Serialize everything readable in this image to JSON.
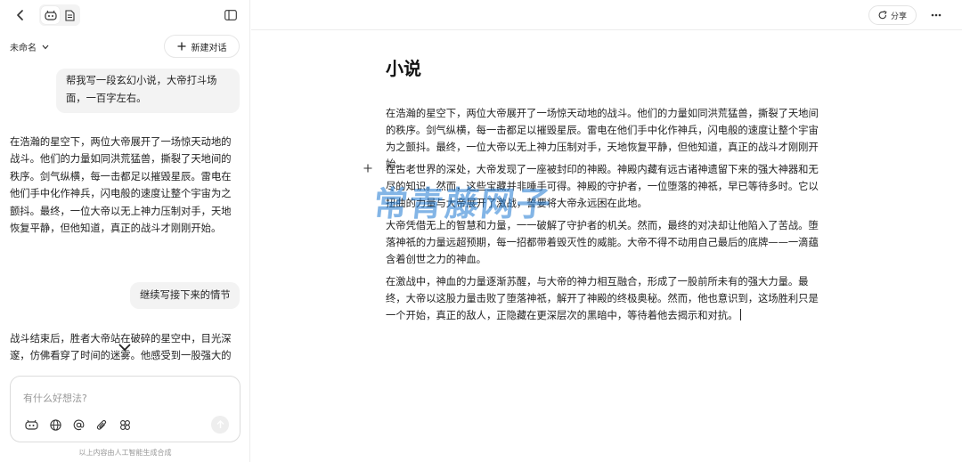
{
  "left_panel": {
    "conversation_title": "未命名",
    "new_chat_label": "新建对话",
    "messages": [
      {
        "role": "user",
        "text": "帮我写一段玄幻小说，大帝打斗场面，一百字左右。"
      },
      {
        "role": "assistant",
        "text": "在浩瀚的星空下，两位大帝展开了一场惊天动地的战斗。他们的力量如同洪荒猛兽，撕裂了天地间的秩序。剑气纵横，每一击都足以摧毁星辰。雷电在他们手中化作神兵，闪电般的速度让整个宇宙为之颤抖。最终，一位大帝以无上神力压制对手，天地恢复平静，但他知道，真正的战斗才刚刚开始。"
      },
      {
        "role": "user",
        "text": "继续写接下来的情节"
      },
      {
        "role": "assistant",
        "text": "战斗结束后，胜者大帝站在破碎的星空中，目光深邃，仿佛看穿了时间的迷雾。他感受到一股强大的"
      }
    ],
    "input": {
      "placeholder": "有什么好想法?"
    },
    "disclaimer": "以上内容由人工智能生成合成"
  },
  "right_panel": {
    "share_label": "分享",
    "document": {
      "title": "小说",
      "paragraphs": [
        "在浩瀚的星空下，两位大帝展开了一场惊天动地的战斗。他们的力量如同洪荒猛兽，撕裂了天地间的秩序。剑气纵横，每一击都足以摧毁星辰。雷电在他们手中化作神兵，闪电般的速度让整个宇宙为之颤抖。最终，一位大帝以无上神力压制对手，天地恢复平静，但他知道，真正的战斗才刚刚开始。",
        "在古老世界的深处，大帝发现了一座被封印的神殿。神殿内藏有远古诸神遗留下来的强大神器和无尽的知识。然而，这些宝藏并非唾手可得。神殿的守护者，一位堕落的神祇，早已等待多时。它以扭曲的力量与大帝展开了激战，誓要将大帝永远困在此地。",
        "大帝凭借无上的智慧和力量，一一破解了守护者的机关。然而，最终的对决却让他陷入了苦战。堕落神祇的力量远超预期，每一招都带着毁灭性的威能。大帝不得不动用自己最后的底牌——一滴蕴含着创世之力的神血。",
        "在激战中，神血的力量逐渐苏醒，与大帝的神力相互融合，形成了一股前所未有的强大力量。最终，大帝以这股力量击败了堕落神祇，解开了神殿的终极奥秘。然而，他也意识到，这场胜利只是一个开始，真正的敌人，正隐藏在更深层次的黑暗中，等待着他去揭示和对抗。"
      ]
    }
  },
  "watermark": "常青藤网子",
  "icons": [
    "back-arrow-icon",
    "bot-avatar-icon",
    "document-icon",
    "sidebar-toggle-icon",
    "chevron-down-icon",
    "plus-icon",
    "globe-icon",
    "at-icon",
    "paperclip-icon",
    "apps-icon",
    "send-arrow-icon",
    "share-icon",
    "more-dots-icon"
  ],
  "colors": {
    "bubble_bg": "#f3f3f3",
    "border": "#ececec",
    "watermark": "#1e78d2"
  }
}
